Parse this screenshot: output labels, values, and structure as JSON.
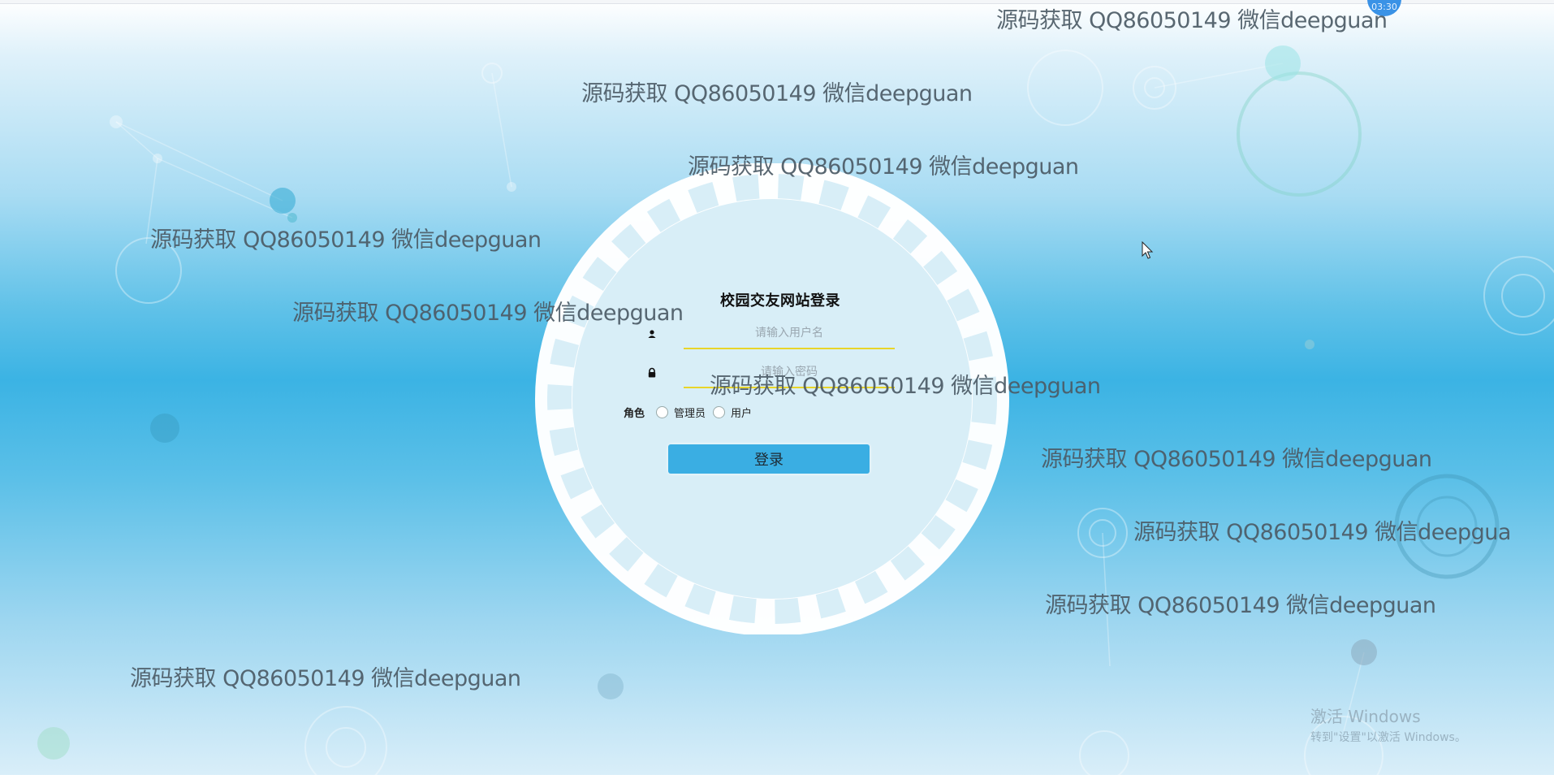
{
  "system": {
    "clock": "03:30"
  },
  "login": {
    "title": "校园交友网站登录",
    "username_placeholder": "请输入用户名",
    "password_placeholder": "请输入密码",
    "role_label": "角色",
    "role_options": [
      "管理员",
      "用户"
    ],
    "login_button": "登录"
  },
  "watermark_text": "源码获取 QQ86050149 微信deepguan",
  "watermark_truncated": "源码获取 QQ86050149 微信deepgua",
  "activation": {
    "line1": "激活 Windows",
    "line2": "转到\"设置\"以激活 Windows。"
  },
  "colors": {
    "accent": "#3aaee3",
    "underline": "#e8d52a",
    "gear": "#ffffff",
    "gear_inner": "#d8eef7"
  }
}
